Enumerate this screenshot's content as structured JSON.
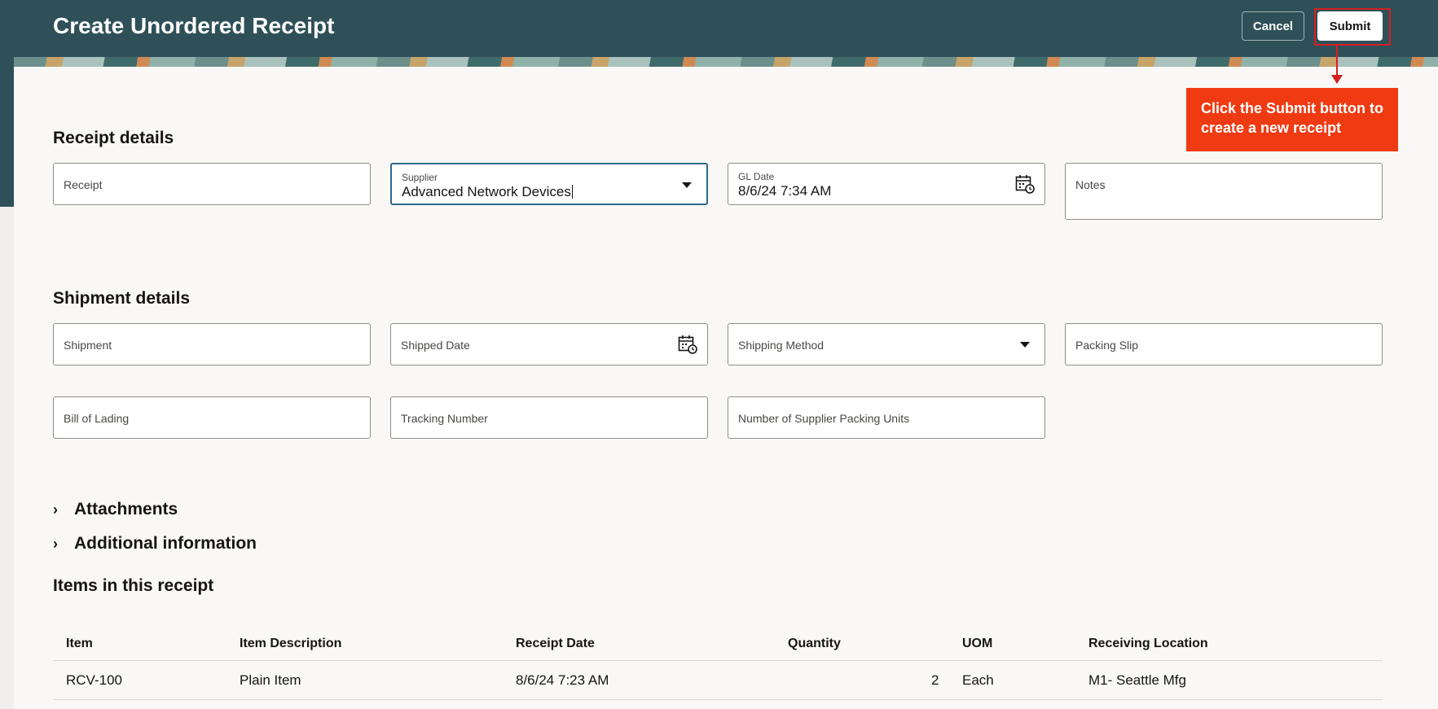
{
  "header": {
    "title": "Create Unordered Receipt",
    "cancel_label": "Cancel",
    "submit_label": "Submit"
  },
  "callout": {
    "text": "Click the Submit button to create a new receipt"
  },
  "receipt_details": {
    "title": "Receipt details",
    "receipt_placeholder": "Receipt",
    "supplier_label": "Supplier",
    "supplier_value": "Advanced Network Devices",
    "gl_date_label": "GL Date",
    "gl_date_value": "8/6/24 7:34 AM",
    "notes_placeholder": "Notes"
  },
  "shipment_details": {
    "title": "Shipment details",
    "shipment_placeholder": "Shipment",
    "shipped_date_placeholder": "Shipped Date",
    "shipping_method_placeholder": "Shipping Method",
    "packing_slip_placeholder": "Packing Slip",
    "bill_of_lading_placeholder": "Bill of Lading",
    "tracking_number_placeholder": "Tracking Number",
    "packing_units_placeholder": "Number of Supplier Packing Units"
  },
  "sections": {
    "attachments": "Attachments",
    "additional_information": "Additional information"
  },
  "items": {
    "title": "Items in this receipt",
    "columns": [
      "Item",
      "Item Description",
      "Receipt Date",
      "Quantity",
      "UOM",
      "Receiving Location"
    ],
    "rows": [
      [
        "RCV-100",
        "Plain Item",
        "8/6/24 7:23 AM",
        "2",
        "Each",
        "M1- Seattle Mfg"
      ]
    ]
  },
  "colors": {
    "header_bg": "#2f5058",
    "callout_bg": "#f03a12",
    "highlight": "#d62020",
    "focus": "#2d6a8c"
  }
}
